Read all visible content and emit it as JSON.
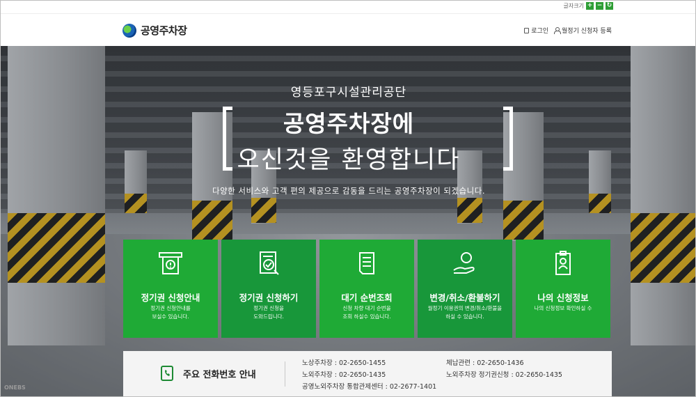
{
  "util": {
    "font_size_label": "글자크기",
    "btn_plus": "+",
    "btn_minus": "−",
    "btn_reset": "↻"
  },
  "header": {
    "logo_text": "공영주차장",
    "login": "로그인",
    "register": "월정기 신청자 등록"
  },
  "hero": {
    "subtitle": "영등포구시설관리공단",
    "title_line1": "공영주차장에",
    "title_line2": "오신것을 환영합니다",
    "description": "다양한 서비스와 고객 편의 제공으로 감동을 드리는 공영주차장이 되겠습니다."
  },
  "cards": [
    {
      "title": "정기권 신청안내",
      "desc1": "정기권 신청안내를",
      "desc2": "보실수 있습니다.",
      "icon": "atm-info-icon"
    },
    {
      "title": "정기권 신청하기",
      "desc1": "정기권 신청을",
      "desc2": "도와드립니다.",
      "icon": "form-check-icon"
    },
    {
      "title": "대기 순번조회",
      "desc1": "신청 차량 대기 순번을",
      "desc2": "조회 하실수 있습니다.",
      "icon": "receipt-icon"
    },
    {
      "title": "변경/취소/환불하기",
      "desc1": "월정기 이용권의 변경/취소/환불을",
      "desc2": "하실 수 있습니다.",
      "icon": "hand-coin-icon"
    },
    {
      "title": "나의 신청정보",
      "desc1": "나의 신청정보 확인하실 수",
      "desc2": "",
      "icon": "id-badge-icon"
    }
  ],
  "phone": {
    "title": "주요 전화번호 안내",
    "rows": [
      [
        "노상주차장 : 02-2650-1455",
        "체납관련 : 02-2650-1436"
      ],
      [
        "노외주차장 : 02-2650-1435",
        "노외주차장 정기권신청 : 02-2650-1435"
      ],
      [
        "공영노외주차장 통합관제센터 : 02-2677-1401",
        ""
      ]
    ]
  },
  "watermark": "ONEBS",
  "colors": {
    "green": "#1faa36",
    "green_dark": "#18973a",
    "panel": "#f4f4f4"
  }
}
